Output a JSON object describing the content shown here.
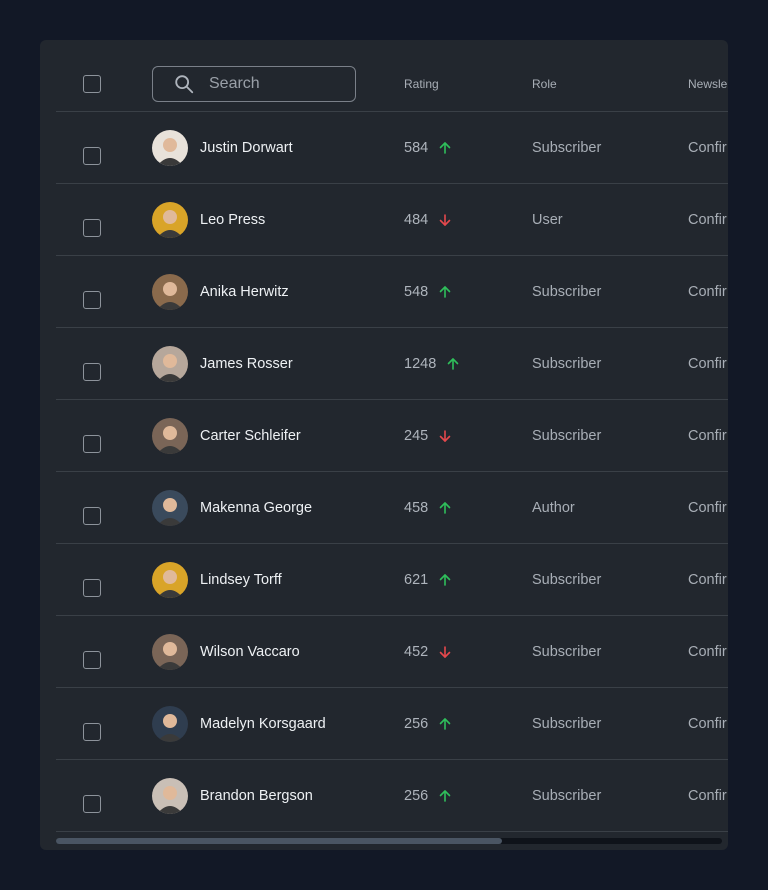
{
  "header": {
    "search_placeholder": "Search",
    "columns": {
      "rating": "Rating",
      "role": "Role",
      "newsletter": "Newsle"
    }
  },
  "colors": {
    "up": "#2fbf5b",
    "down": "#e5484d",
    "background": "#121826",
    "card": "#22272e"
  },
  "rows": [
    {
      "name": "Justin Dorwart",
      "rating": "584",
      "trend": "up",
      "role": "Subscriber",
      "newsletter": "Confir",
      "avatar_color": "#e8e2da"
    },
    {
      "name": "Leo Press",
      "rating": "484",
      "trend": "down",
      "role": "User",
      "newsletter": "Confir",
      "avatar_color": "#d9a428"
    },
    {
      "name": "Anika Herwitz",
      "rating": "548",
      "trend": "up",
      "role": "Subscriber",
      "newsletter": "Confir",
      "avatar_color": "#8a6a4c"
    },
    {
      "name": "James Rosser",
      "rating": "1248",
      "trend": "up",
      "role": "Subscriber",
      "newsletter": "Confir",
      "avatar_color": "#b6a79b"
    },
    {
      "name": "Carter Schleifer",
      "rating": "245",
      "trend": "down",
      "role": "Subscriber",
      "newsletter": "Confir",
      "avatar_color": "#7a6557"
    },
    {
      "name": "Makenna George",
      "rating": "458",
      "trend": "up",
      "role": "Author",
      "newsletter": "Confir",
      "avatar_color": "#3a4a5c"
    },
    {
      "name": "Lindsey Torff",
      "rating": "621",
      "trend": "up",
      "role": "Subscriber",
      "newsletter": "Confir",
      "avatar_color": "#d9a428"
    },
    {
      "name": "Wilson Vaccaro",
      "rating": "452",
      "trend": "down",
      "role": "Subscriber",
      "newsletter": "Confir",
      "avatar_color": "#7a6557"
    },
    {
      "name": "Madelyn Korsgaard",
      "rating": "256",
      "trend": "up",
      "role": "Subscriber",
      "newsletter": "Confir",
      "avatar_color": "#2f3d4f"
    },
    {
      "name": "Brandon Bergson",
      "rating": "256",
      "trend": "up",
      "role": "Subscriber",
      "newsletter": "Confir",
      "avatar_color": "#c9bfb6"
    }
  ],
  "scroll": {
    "position_fraction": 0.67
  }
}
